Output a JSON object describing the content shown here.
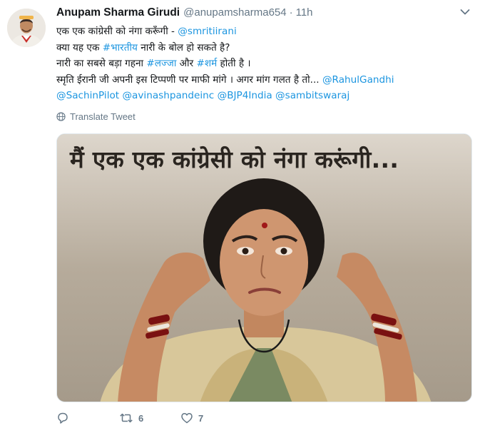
{
  "tweet": {
    "author_name": "Anupam Sharma Girudi",
    "author_handle": "@anupamsharma654",
    "separator": "·",
    "time": "11h",
    "lines": [
      [
        {
          "text": "एक एक कांग्रेसी को नंगा करूँगी - ",
          "link": false
        },
        {
          "text": "@smritiirani",
          "link": true
        }
      ],
      [
        {
          "text": "क्या यह एक ",
          "link": false
        },
        {
          "text": "#भारतीय",
          "link": true
        },
        {
          "text": " नारी के बोल हो सकते है?",
          "link": false
        }
      ],
      [
        {
          "text": "नारी का सबसे बड़ा गहना ",
          "link": false
        },
        {
          "text": "#लज्जा",
          "link": true
        },
        {
          "text": " और ",
          "link": false
        },
        {
          "text": "#शर्म",
          "link": true
        },
        {
          "text": " होती है ।",
          "link": false
        }
      ],
      [
        {
          "text": "स्मृति ईरानी जी अपनी इस टिप्पणी पर माफी मांगे । अगर मांग गलत है तो... ",
          "link": false
        },
        {
          "text": "@RahulGandhi",
          "link": true
        }
      ],
      [
        {
          "text": "@SachinPilot @avinashpandeinc @BJP4India @sambitswaraj",
          "link": true
        }
      ]
    ],
    "translate_label": "Translate Tweet",
    "media_caption": "मैं एक एक कांग्रेसी को नंगा करूंगी...",
    "reply_count": "",
    "retweet_count": "6",
    "like_count": "7"
  },
  "colors": {
    "link": "#1b95e0",
    "secondary_text": "#657786",
    "primary_text": "#14171a"
  },
  "icons": {
    "avatar": "user-avatar",
    "caret": "chevron-down-icon",
    "globe": "globe-icon",
    "reply": "reply-icon",
    "retweet": "retweet-icon",
    "like": "heart-icon"
  }
}
